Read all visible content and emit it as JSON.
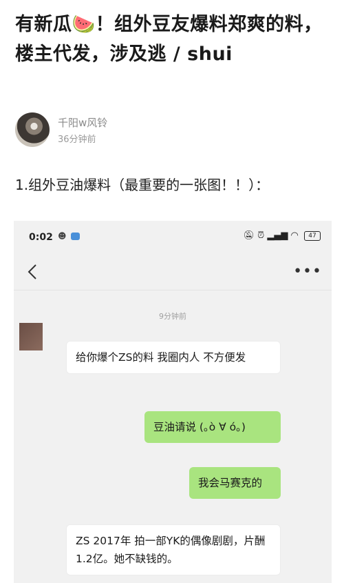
{
  "post": {
    "title": "有新瓜🍉！组外豆友爆料郑爽的料，楼主代发，涉及逃 / shui",
    "author_name": "千阳w风铃",
    "post_time": "36分钟前",
    "section_heading": "1.组外豆油爆料（最重要的一张图！！）："
  },
  "chat_screenshot": {
    "status_bar": {
      "time": "0:02",
      "battery": "47"
    },
    "message_time": "9分钟前",
    "messages": [
      {
        "side": "received",
        "text": "给你爆个ZS的料 我圈内人 不方便发"
      },
      {
        "side": "sent",
        "text": "豆油请说 (｡ò ∀ ó｡)"
      },
      {
        "side": "sent",
        "text": "我会马赛克的"
      },
      {
        "side": "received",
        "text": "ZS 2017年 拍一部YK的偶像剧剧，片酬1.2亿。她不缺钱的。"
      }
    ]
  }
}
